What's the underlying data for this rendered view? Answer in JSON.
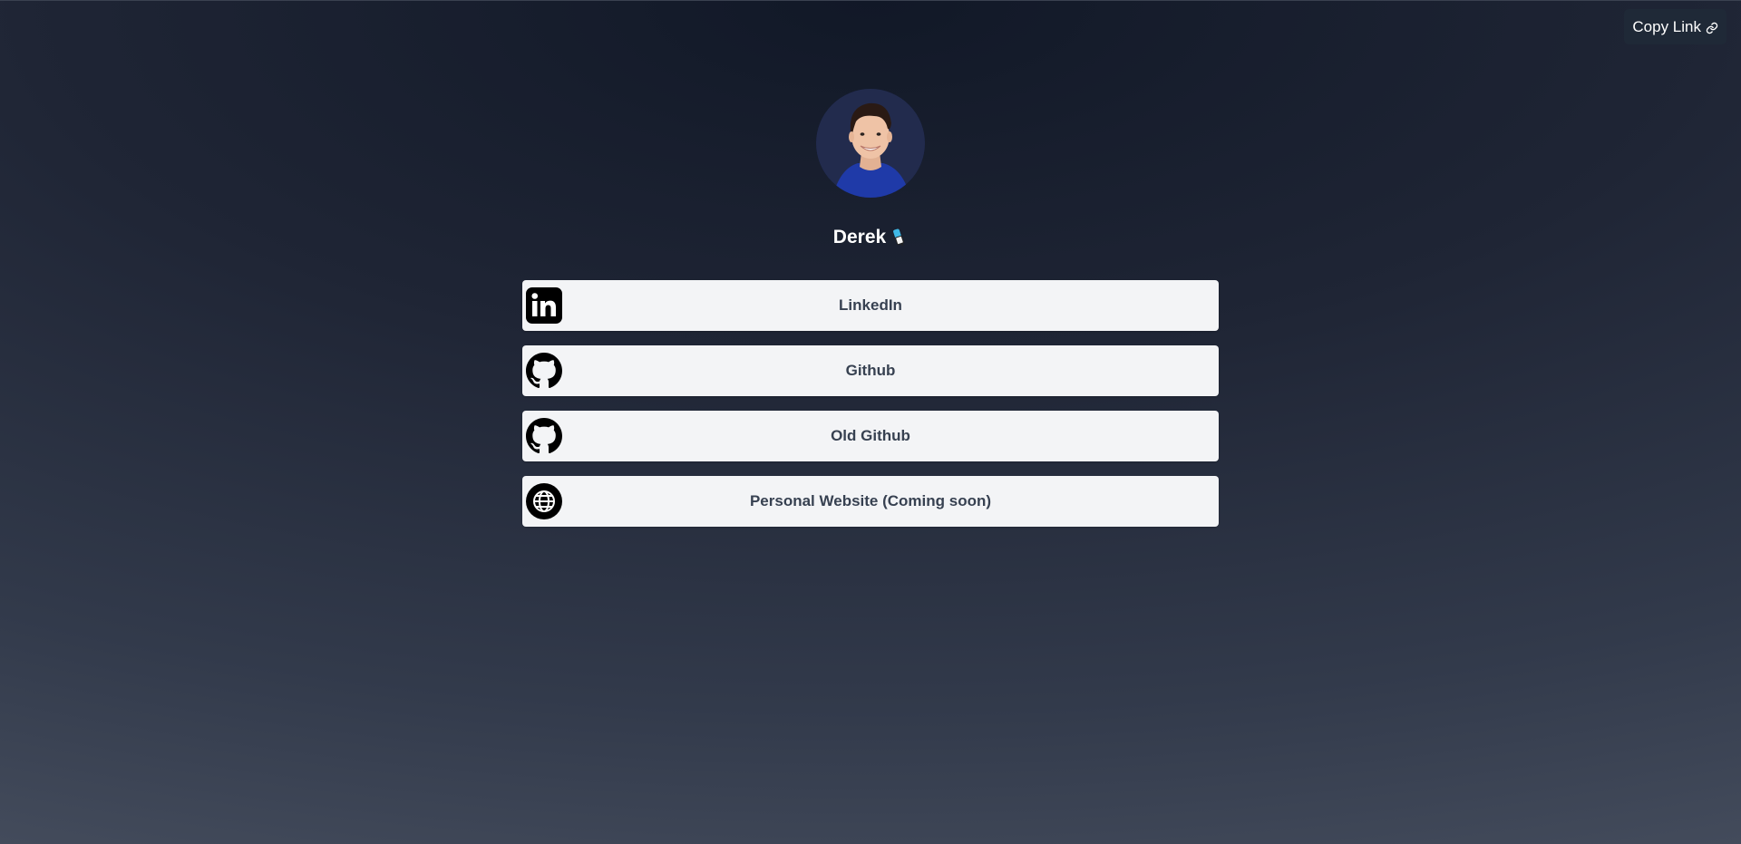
{
  "header": {
    "copy_link_label": "Copy Link",
    "copy_link_icon": "link-icon"
  },
  "profile": {
    "name": "Derek",
    "name_icon": "pen-icon",
    "avatar": "profile-photo"
  },
  "links": [
    {
      "label": "LinkedIn",
      "icon": "linkedin-icon"
    },
    {
      "label": "Github",
      "icon": "github-icon"
    },
    {
      "label": "Old Github",
      "icon": "github-icon"
    },
    {
      "label": "Personal Website (Coming soon)",
      "icon": "globe-icon"
    }
  ],
  "colors": {
    "card_background": "#f3f4f6",
    "card_text": "#374151",
    "button_background": "#1f2937",
    "page_gradient_top": "#111827",
    "page_gradient_bottom": "#4b5363"
  }
}
